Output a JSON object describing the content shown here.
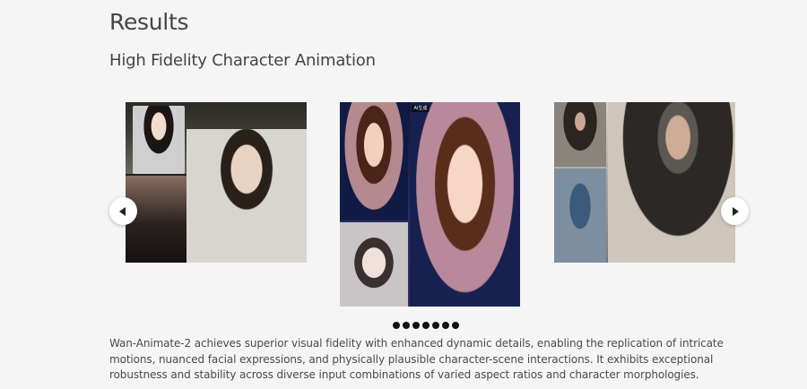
{
  "section": {
    "title": "Results"
  },
  "subsection": {
    "title": "High Fidelity Character Animation"
  },
  "carousel": {
    "prev_icon": "chevron-left-icon",
    "next_icon": "chevron-right-icon",
    "slides": [
      {
        "label": ""
      },
      {
        "label": "AI生成"
      },
      {
        "label": ""
      }
    ],
    "dot_count": 7,
    "active_dot": 0
  },
  "description": {
    "text": "Wan-Animate-2 achieves superior visual fidelity with enhanced dynamic details, enabling the replication of intricate motions, nuanced facial expressions, and physically plausible character-scene interactions. It exhibits exceptional robustness and stability across diverse input combinations of varied aspect ratios and character morphologies."
  },
  "colors": {
    "background": "#f5f5f5",
    "heading": "#444444",
    "body_text": "#4a4a4a",
    "dot": "#111111",
    "arrow_bg": "#ffffff"
  }
}
